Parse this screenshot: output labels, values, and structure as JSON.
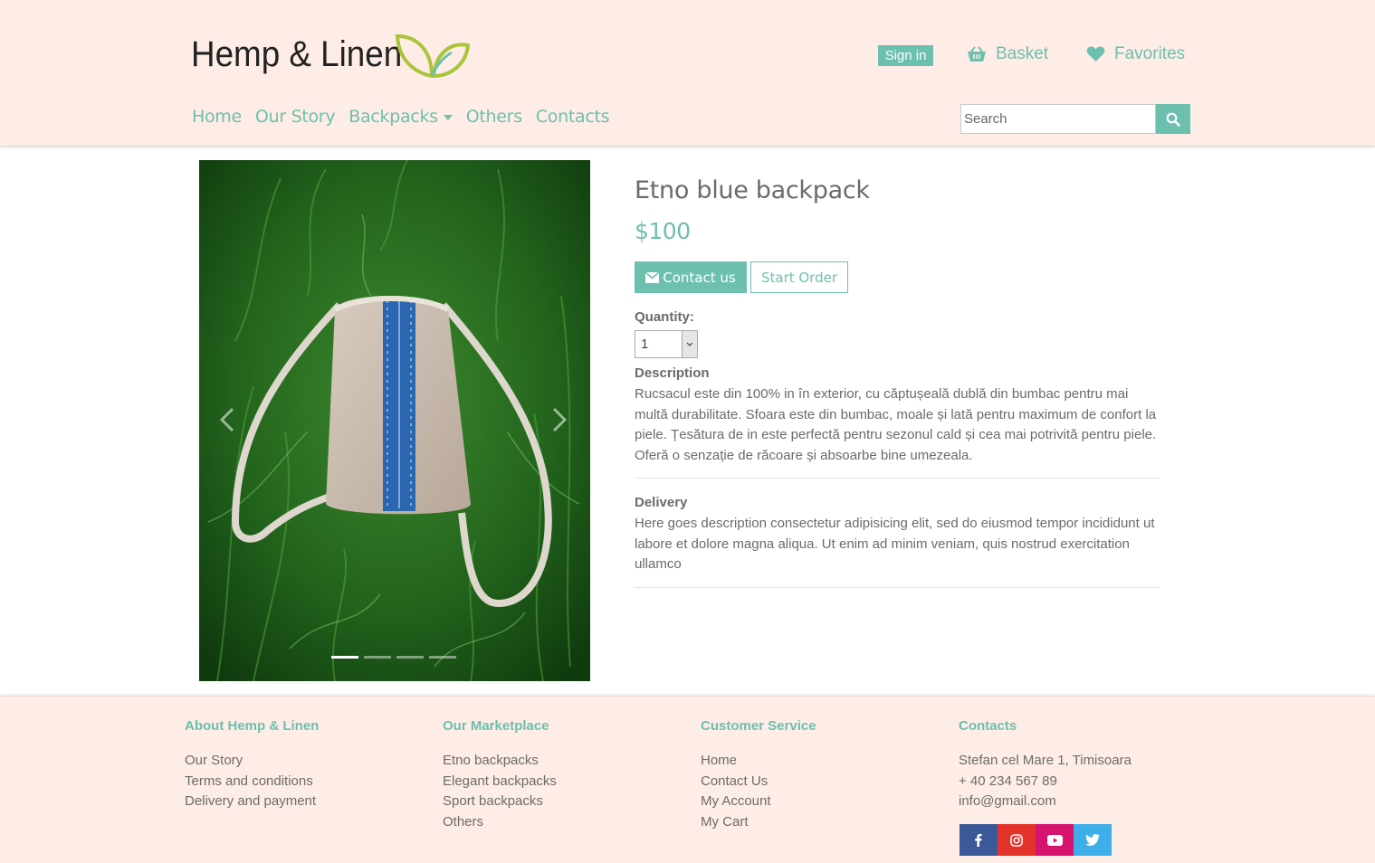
{
  "header": {
    "logo_text": "Hemp & Linen",
    "signin_label": "Sign in",
    "basket_label": "Basket",
    "favorites_label": "Favorites",
    "nav": [
      {
        "label": "Home"
      },
      {
        "label": "Our Story"
      },
      {
        "label": "Backpacks"
      },
      {
        "label": "Others"
      },
      {
        "label": "Contacts"
      }
    ],
    "search_placeholder": "Search"
  },
  "product": {
    "title": "Etno blue backpack",
    "price": "$100",
    "contact_label": "Contact us",
    "order_label": "Start Order",
    "quantity_label": "Quantity:",
    "quantity_value": "1",
    "description_label": "Description",
    "description_text": "Rucsacul este din 100% in în exterior, cu căptușeală dublă din bumbac pentru mai multă durabilitate. Sfoara este din bumbac, moale și lată pentru maximum de confort la piele. Țesătura de in este perfectă pentru sezonul cald și cea mai potrivită pentru piele. Oferă o senzație de răcoare și absoarbe bine umezeala.",
    "delivery_label": "Delivery",
    "delivery_text": "Here goes description consectetur adipisicing elit, sed do eiusmod tempor incididunt ut labore et dolore magna aliqua. Ut enim ad minim veniam, quis nostrud exercitation ullamco",
    "carousel_slides": 4,
    "carousel_active": 1
  },
  "footer": {
    "about": {
      "title": "About Hemp & Linen",
      "links": [
        "Our Story",
        "Terms and conditions",
        "Delivery and payment"
      ]
    },
    "marketplace": {
      "title": "Our Marketplace",
      "links": [
        "Etno backpacks",
        "Elegant backpacks",
        "Sport backpacks",
        "Others"
      ]
    },
    "service": {
      "title": "Customer Service",
      "links": [
        "Home",
        "Contact Us",
        "My Account",
        "My Cart"
      ]
    },
    "contacts": {
      "title": "Contacts",
      "lines": [
        "Stefan cel Mare 1, Timisoara",
        "+ 40 234 567 89",
        "info@gmail.com"
      ]
    },
    "social": [
      {
        "icon": "facebook-icon",
        "color": "#3b5998"
      },
      {
        "icon": "instagram-icon",
        "color": "#e4332b"
      },
      {
        "icon": "youtube-icon",
        "color": "#d6136f"
      },
      {
        "icon": "twitter-icon",
        "color": "#3eaee8"
      }
    ]
  },
  "colors": {
    "accent": "#6dbfae",
    "header_bg": "#feede6",
    "text": "#6b6b6b"
  }
}
